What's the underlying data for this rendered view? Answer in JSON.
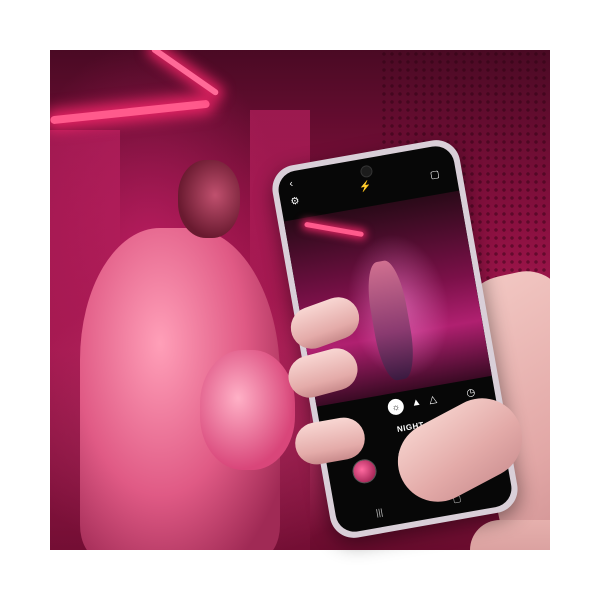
{
  "camera_ui": {
    "mode_label": "NIGHT",
    "top_icons": [
      "back-icon",
      "settings-icon",
      "flash-icon",
      "aspect-ratio-icon"
    ],
    "mode_icons": [
      "night-mode-icon",
      "scene-icon",
      "scene-icon",
      "timer-icon"
    ]
  },
  "colors": {
    "neon_pink": "#ff5a8c",
    "scene_magenta": "#b01a55",
    "screen_black": "#070707"
  }
}
